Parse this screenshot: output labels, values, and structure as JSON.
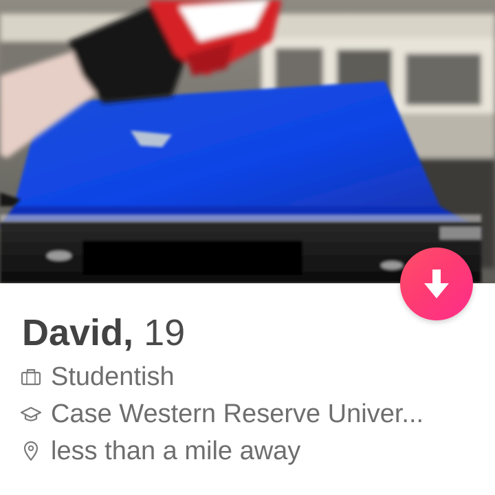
{
  "profile": {
    "name": "David,",
    "age": "19",
    "job": "Studentish",
    "school": "Case Western Reserve Univer...",
    "distance": "less than a mile away"
  },
  "icons": {
    "job": "briefcase-icon",
    "school": "graduation-cap-icon",
    "distance": "location-pin-icon",
    "action": "arrow-down-icon"
  },
  "colors": {
    "accent_start": "#fd5068",
    "accent_end": "#ff2d8a",
    "name_text": "#424242",
    "detail_text": "#6e6e6e"
  }
}
